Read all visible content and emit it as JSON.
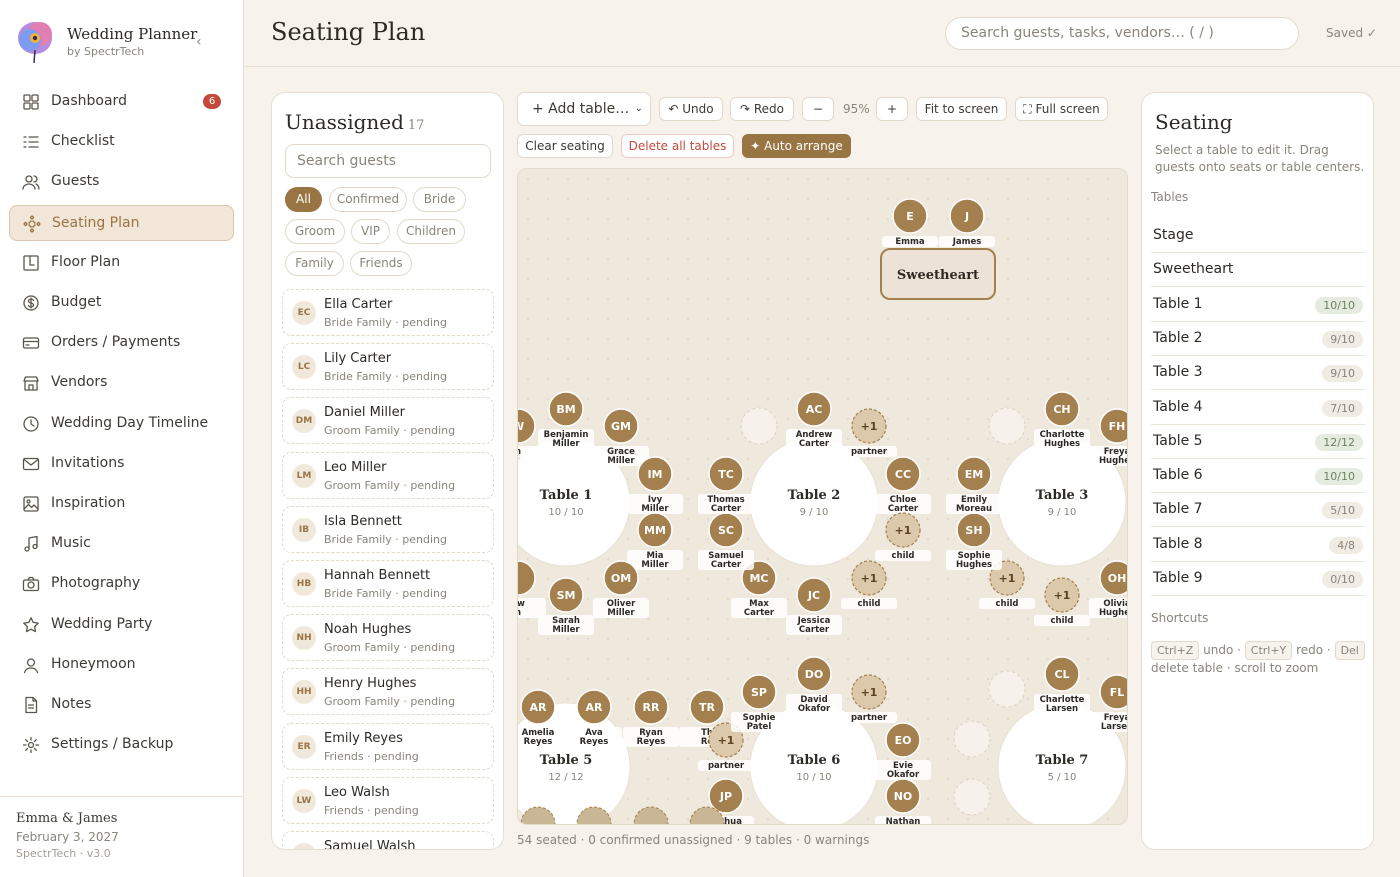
{
  "app": {
    "title": "Wedding Planner",
    "subtitle": "by SpectrTech",
    "collapse_icon": "chevron-left-icon"
  },
  "nav": [
    {
      "label": "Dashboard",
      "icon": "grid-icon",
      "badge": "6"
    },
    {
      "label": "Checklist",
      "icon": "list-icon"
    },
    {
      "label": "Guests",
      "icon": "users-icon"
    },
    {
      "label": "Seating Plan",
      "icon": "seating-icon",
      "active": true
    },
    {
      "label": "Floor Plan",
      "icon": "floor-plan-icon"
    },
    {
      "label": "Budget",
      "icon": "dollar-icon"
    },
    {
      "label": "Orders / Payments",
      "icon": "card-icon"
    },
    {
      "label": "Vendors",
      "icon": "store-icon"
    },
    {
      "label": "Wedding Day Timeline",
      "icon": "clock-icon"
    },
    {
      "label": "Invitations",
      "icon": "mail-icon"
    },
    {
      "label": "Inspiration",
      "icon": "image-icon"
    },
    {
      "label": "Music",
      "icon": "music-icon"
    },
    {
      "label": "Photography",
      "icon": "camera-icon"
    },
    {
      "label": "Wedding Party",
      "icon": "star-icon"
    },
    {
      "label": "Honeymoon",
      "icon": "person-icon"
    },
    {
      "label": "Notes",
      "icon": "notes-icon"
    },
    {
      "label": "Settings / Backup",
      "icon": "gear-icon"
    }
  ],
  "footer": {
    "couple": "Emma & James",
    "date": "February 3, 2027",
    "version": "SpectrTech · v3.0"
  },
  "header": {
    "title": "Seating Plan",
    "search_placeholder": "Search guests, tasks, vendors…  ( / )",
    "saved": "Saved ✓"
  },
  "unassigned": {
    "title": "Unassigned",
    "count": "17",
    "search_placeholder": "Search guests",
    "filters": [
      "All",
      "Confirmed",
      "Bride",
      "Groom",
      "VIP",
      "Children",
      "Family",
      "Friends"
    ],
    "active_filter": "All",
    "guests": [
      {
        "initials": "EC",
        "name": "Ella Carter",
        "meta": "Bride Family · pending"
      },
      {
        "initials": "LC",
        "name": "Lily Carter",
        "meta": "Bride Family · pending"
      },
      {
        "initials": "DM",
        "name": "Daniel Miller",
        "meta": "Groom Family · pending"
      },
      {
        "initials": "LM",
        "name": "Leo Miller",
        "meta": "Groom Family · pending"
      },
      {
        "initials": "IB",
        "name": "Isla Bennett",
        "meta": "Bride Family · pending"
      },
      {
        "initials": "HB",
        "name": "Hannah Bennett",
        "meta": "Bride Family · pending"
      },
      {
        "initials": "NH",
        "name": "Noah Hughes",
        "meta": "Groom Family · pending"
      },
      {
        "initials": "HH",
        "name": "Henry Hughes",
        "meta": "Groom Family · pending"
      },
      {
        "initials": "ER",
        "name": "Emily Reyes",
        "meta": "Friends · pending"
      },
      {
        "initials": "LW",
        "name": "Leo Walsh",
        "meta": "Friends · pending"
      },
      {
        "initials": "SW",
        "name": "Samuel Walsh",
        "meta": ""
      }
    ]
  },
  "toolbar": {
    "add_table": "+ Add table…",
    "undo": "↶ Undo",
    "redo": "↷ Redo",
    "zoom_out": "−",
    "zoom": "95%",
    "zoom_in": "+",
    "fit": "Fit to screen",
    "fullscreen": "⛶ Full screen",
    "clear": "Clear seating",
    "delete_all": "Delete all tables",
    "auto": "✦ Auto arrange"
  },
  "canvas": {
    "tables": [
      {
        "name": "Sweetheart"
      },
      {
        "name": "Table 1",
        "count": "10 / 10"
      },
      {
        "name": "Table 2",
        "count": "9 / 10"
      },
      {
        "name": "Table 3",
        "count": "9 / 10"
      },
      {
        "name": "Table 5",
        "count": "12 / 12"
      },
      {
        "name": "Table 6",
        "count": "10 / 10"
      },
      {
        "name": "Table 7",
        "count": "5 / 10"
      }
    ],
    "guests": [
      {
        "initials": "E",
        "name": "Emma"
      },
      {
        "initials": "J",
        "name": "James"
      },
      {
        "initials": "BM",
        "name": "Benjamin Miller"
      },
      {
        "initials": "GM",
        "name": "Grace Miller"
      },
      {
        "initials": "IM",
        "name": "Ivy Miller"
      },
      {
        "initials": "MM",
        "name": "Mia Miller"
      },
      {
        "initials": "OM",
        "name": "Oliver Miller"
      },
      {
        "initials": "SM",
        "name": "Sarah Miller"
      },
      {
        "initials": "W",
        "name": "h"
      },
      {
        "initials": "",
        "name": "ew h"
      },
      {
        "initials": "AC",
        "name": "Andrew Carter"
      },
      {
        "initials": "+1",
        "name": "partner"
      },
      {
        "initials": "CC",
        "name": "Chloe Carter"
      },
      {
        "initials": "+1",
        "name": "child"
      },
      {
        "initials": "+1",
        "name": "child"
      },
      {
        "initials": "JC",
        "name": "Jessica Carter"
      },
      {
        "initials": "MC",
        "name": "Max Carter"
      },
      {
        "initials": "SC",
        "name": "Samuel Carter"
      },
      {
        "initials": "TC",
        "name": "Thomas Carter"
      },
      {
        "initials": "CH",
        "name": "Charlotte Hughes"
      },
      {
        "initials": "FH",
        "name": "Freya Hughes"
      },
      {
        "initials": "OH",
        "name": "Olivia Hughes"
      },
      {
        "initials": "+1",
        "name": "child"
      },
      {
        "initials": "+1",
        "name": "child"
      },
      {
        "initials": "SH",
        "name": "Sophie Hughes"
      },
      {
        "initials": "EM",
        "name": "Emily Moreau"
      },
      {
        "initials": "AR",
        "name": "Amelia Reyes"
      },
      {
        "initials": "AR",
        "name": "Ava Reyes"
      },
      {
        "initials": "RR",
        "name": "Ryan Reyes"
      },
      {
        "initials": "TR",
        "name": "Th Re"
      },
      {
        "initials": "DO",
        "name": "David Okafor"
      },
      {
        "initials": "+1",
        "name": "partner"
      },
      {
        "initials": "EO",
        "name": "Evie Okafor"
      },
      {
        "initials": "NO",
        "name": "Nathan"
      },
      {
        "initials": "JP",
        "name": "Joshua"
      },
      {
        "initials": "+1",
        "name": "partner"
      },
      {
        "initials": "SP",
        "name": "Sophie Patel"
      },
      {
        "initials": "CL",
        "name": "Charlotte Larsen"
      },
      {
        "initials": "FL",
        "name": "Freya Larsen"
      }
    ]
  },
  "status": "54 seated · 0 confirmed unassigned · 9 tables · 0 warnings",
  "seating": {
    "title": "Seating",
    "hint": "Select a table to edit it. Drag guests onto seats or table centers.",
    "tables_label": "Tables",
    "tables": [
      {
        "name": "Stage",
        "badge": ""
      },
      {
        "name": "Sweetheart",
        "badge": ""
      },
      {
        "name": "Table 1",
        "badge": "10/10",
        "full": true
      },
      {
        "name": "Table 2",
        "badge": "9/10"
      },
      {
        "name": "Table 3",
        "badge": "9/10"
      },
      {
        "name": "Table 4",
        "badge": "7/10"
      },
      {
        "name": "Table 5",
        "badge": "12/12",
        "full": true
      },
      {
        "name": "Table 6",
        "badge": "10/10",
        "full": true
      },
      {
        "name": "Table 7",
        "badge": "5/10"
      },
      {
        "name": "Table 8",
        "badge": "4/8"
      },
      {
        "name": "Table 9",
        "badge": "0/10"
      }
    ],
    "shortcuts_label": "Shortcuts",
    "shortcuts": {
      "k1": "Ctrl+Z",
      "t1": " undo · ",
      "k2": "Ctrl+Y",
      "t2": " redo · ",
      "k3": "Del",
      "t3": " delete table · scroll to zoom"
    }
  },
  "colors": {
    "accent": "#9a7544",
    "danger": "#c44a3c",
    "seat": "#9a7544",
    "bg": "#f7f3ec"
  }
}
